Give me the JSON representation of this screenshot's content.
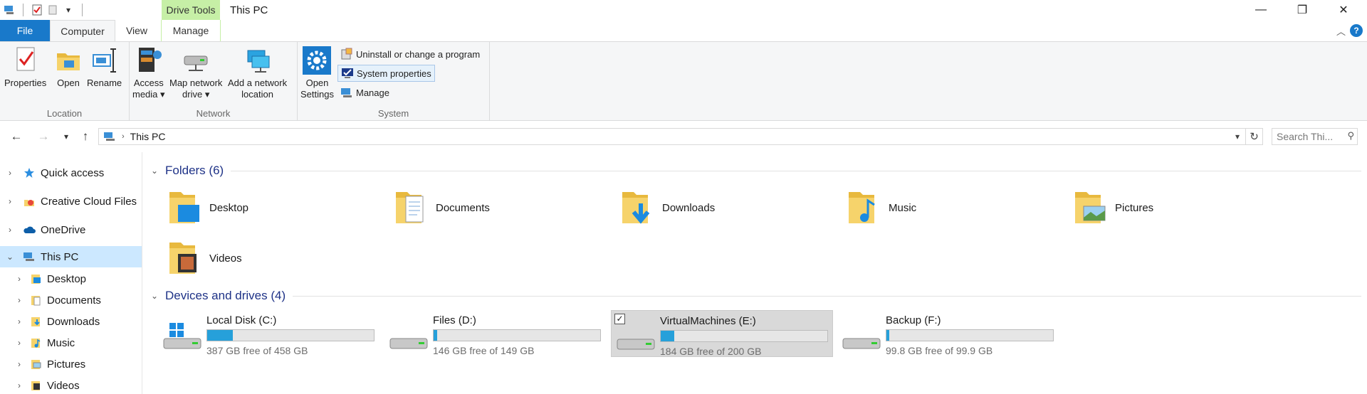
{
  "window": {
    "context_tab": "Drive Tools",
    "title": "This PC",
    "min_glyph": "—",
    "restore_glyph": "❐",
    "close_glyph": "✕"
  },
  "ribbon_tabs": {
    "file": "File",
    "computer": "Computer",
    "view": "View",
    "manage": "Manage"
  },
  "ribbon": {
    "location": {
      "label": "Location",
      "properties": "Properties",
      "open": "Open",
      "rename": "Rename"
    },
    "network": {
      "label": "Network",
      "access_media_1": "Access",
      "access_media_2": "media ▾",
      "map_drive_1": "Map network",
      "map_drive_2": "drive ▾",
      "add_location_1": "Add a network",
      "add_location_2": "location"
    },
    "system": {
      "label": "System",
      "open_settings_1": "Open",
      "open_settings_2": "Settings",
      "uninstall": "Uninstall or change a program",
      "system_properties": "System properties",
      "manage": "Manage"
    }
  },
  "address": {
    "path": "This PC",
    "search_placeholder": "Search Thi..."
  },
  "nav_pane": {
    "items": [
      {
        "label": "Quick access"
      },
      {
        "label": "Creative Cloud Files"
      },
      {
        "label": "OneDrive"
      },
      {
        "label": "This PC"
      },
      {
        "label": "Desktop"
      },
      {
        "label": "Documents"
      },
      {
        "label": "Downloads"
      },
      {
        "label": "Music"
      },
      {
        "label": "Pictures"
      },
      {
        "label": "Videos"
      }
    ]
  },
  "folders": {
    "heading": "Folders (6)",
    "items": [
      {
        "name": "Desktop"
      },
      {
        "name": "Documents"
      },
      {
        "name": "Downloads"
      },
      {
        "name": "Music"
      },
      {
        "name": "Pictures"
      },
      {
        "name": "Videos"
      }
    ]
  },
  "drives": {
    "heading": "Devices and drives (4)",
    "items": [
      {
        "name": "Local Disk (C:)",
        "free_text": "387 GB free of 458 GB",
        "used_fraction": 0.155
      },
      {
        "name": "Files (D:)",
        "free_text": "146 GB free of 149 GB",
        "used_fraction": 0.02
      },
      {
        "name": "VirtualMachines (E:)",
        "free_text": "184 GB free of 200 GB",
        "used_fraction": 0.08
      },
      {
        "name": "Backup (F:)",
        "free_text": "99.8 GB free of 99.9 GB",
        "used_fraction": 0.003
      }
    ]
  },
  "colors": {
    "accent": "#1979ca",
    "context_tab": "#c6efa6",
    "selection": "#cce8ff",
    "drive_bar": "#26a0da",
    "section_heading": "#1e3287"
  }
}
